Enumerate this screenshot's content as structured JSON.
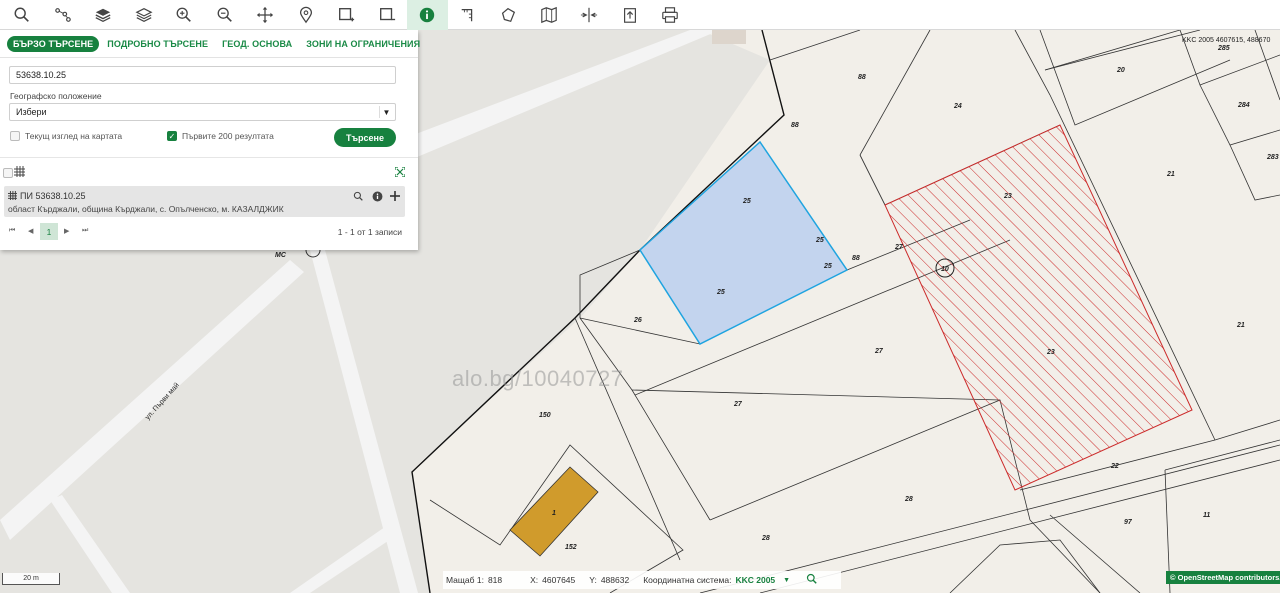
{
  "toolbar": {
    "buttons": [
      {
        "name": "search-icon"
      },
      {
        "name": "route-icon"
      },
      {
        "name": "layers-filled-icon"
      },
      {
        "name": "layers-icon"
      },
      {
        "name": "zoom-in-icon"
      },
      {
        "name": "zoom-out-icon"
      },
      {
        "name": "pan-icon"
      },
      {
        "name": "marker-icon"
      },
      {
        "name": "select-rect-icon"
      },
      {
        "name": "select-rect-minus-icon"
      },
      {
        "name": "info-icon",
        "active": true
      },
      {
        "name": "measure-line-icon"
      },
      {
        "name": "measure-area-icon"
      },
      {
        "name": "map-icon"
      },
      {
        "name": "split-icon"
      },
      {
        "name": "export-icon"
      },
      {
        "name": "print-icon"
      }
    ]
  },
  "panel": {
    "tabs": [
      {
        "label": "БЪРЗО ТЪРСЕНЕ",
        "active": true
      },
      {
        "label": "ПОДРОБНО ТЪРСЕНЕ"
      },
      {
        "label": "ГЕОД. ОСНОВА"
      },
      {
        "label": "ЗОНИ НА ОГРАНИЧЕНИЯ"
      }
    ],
    "search_value": "53638.10.25",
    "geo_label": "Географско положение",
    "geo_select_value": "Избери",
    "current_view_label": "Текущ изглед на картата",
    "first200_label": "Първите 200 резултата",
    "search_button": "Търсене",
    "result": {
      "title": "ПИ 53638.10.25",
      "subtitle": "област Кърджали, община Кърджали, с. Опълченско, м. КАЗАЛДЖИК"
    },
    "pager": {
      "first": "⏮",
      "prev": "◀",
      "page": "1",
      "next": "▶",
      "last": "⏭",
      "info": "1 - 1 от 1 записи"
    }
  },
  "statusbar": {
    "scale_label": "Мащаб 1:",
    "scale_value": "818",
    "x_label": "X:",
    "x_value": "4607645",
    "y_label": "Y:",
    "y_value": "488632",
    "coord_label": "Координатна система:",
    "coord_value": "KKC 2005"
  },
  "crs_readout": "KKC 2005 4607615, 488670",
  "scale_bar": "20 m",
  "osm": "© OpenStreetMap contributors.",
  "watermark": "alo.bg/10040727",
  "map": {
    "colors": {
      "background": "#e6e4df",
      "road": "#d7d7d7",
      "land": "#f2efe9",
      "selected_fill": "#c3d4ee",
      "selected_stroke": "#1fa4e0",
      "hatch": "#cc2a2a",
      "building": "#d09b2c"
    },
    "parcel_labels": [
      "88",
      "24",
      "20",
      "285",
      "284",
      "283",
      "21",
      "88",
      "25",
      "25",
      "25",
      "25",
      "88",
      "27",
      "23",
      "10",
      "26",
      "27",
      "23",
      "21",
      "27",
      "150",
      "22",
      "28",
      "97",
      "11",
      "1",
      "152",
      "28",
      "МС"
    ],
    "street_label": "ул. Първи май"
  }
}
